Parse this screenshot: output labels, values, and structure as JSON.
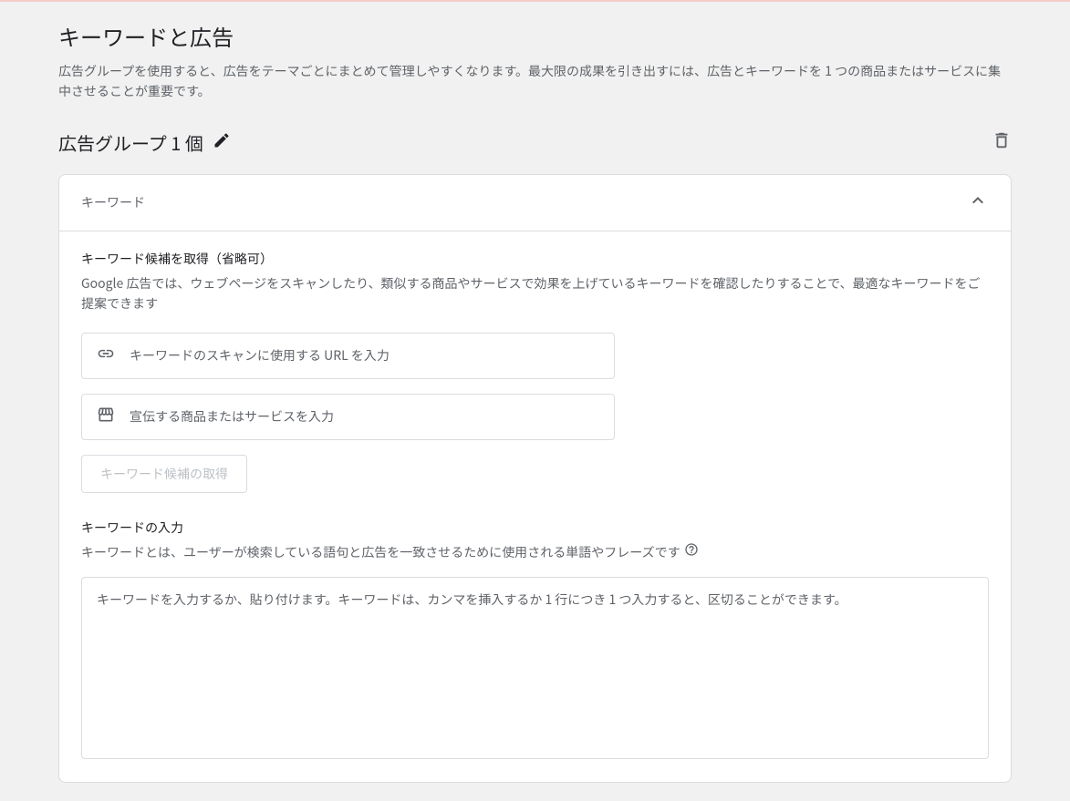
{
  "page": {
    "title": "キーワードと広告",
    "description": "広告グループを使用すると、広告をテーマごとにまとめて管理しやすくなります。最大限の成果を引き出すには、広告とキーワードを 1 つの商品またはサービスに集中させることが重要です。"
  },
  "ad_group": {
    "title": "広告グループ 1 個"
  },
  "card": {
    "header_title": "キーワード"
  },
  "suggest": {
    "title": "キーワード候補を取得（省略可）",
    "description": "Google 広告では、ウェブページをスキャンしたり、類似する商品やサービスで効果を上げているキーワードを確認したりすることで、最適なキーワードをご提案できます",
    "url_placeholder": "キーワードのスキャンに使用する URL を入力",
    "product_placeholder": "宣伝する商品またはサービスを入力",
    "button_label": "キーワード候補の取得"
  },
  "enter": {
    "title": "キーワードの入力",
    "description": "キーワードとは、ユーザーが検索している語句と広告を一致させるために使用される単語やフレーズです",
    "textarea_placeholder": "キーワードを入力するか、貼り付けます。キーワードは、カンマを挿入するか 1 行につき 1 つ入力すると、区切ることができます。"
  }
}
